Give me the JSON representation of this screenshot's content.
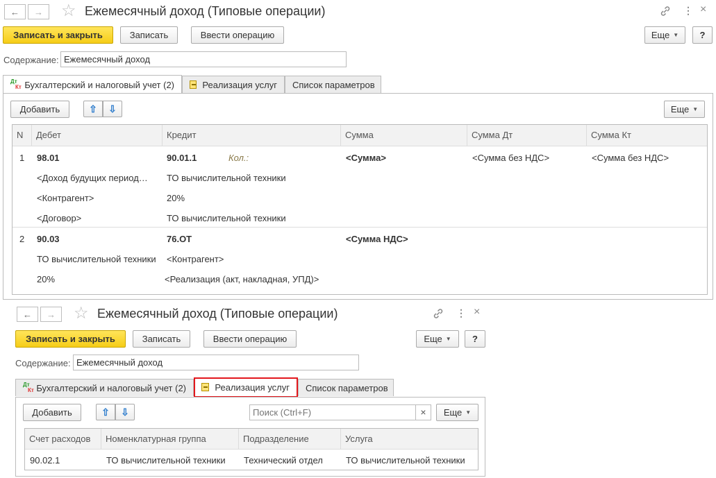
{
  "window1": {
    "title": "Ежемесячный доход (Типовые операции)",
    "buttons": {
      "save_close": "Записать и закрыть",
      "save": "Записать",
      "enter_op": "Ввести операцию",
      "more": "Еще",
      "help": "?"
    },
    "content_label": "Содержание:",
    "content_value": "Ежемесячный доход",
    "tabs": [
      "Бухгалтерский и налоговый учет (2)",
      "Реализация услуг",
      "Список параметров"
    ],
    "tab_icon_top": "Дт",
    "tab_icon_bottom": "Кт",
    "add_label": "Добавить",
    "more_label": "Еще",
    "columns": [
      "N",
      "Дебет",
      "Кредит",
      "Сумма",
      "Сумма Дт",
      "Сумма Кт"
    ],
    "rows": [
      {
        "n": "1",
        "debit": [
          "98.01",
          "<Доход будущих период…",
          "<Контрагент>",
          "<Договор>"
        ],
        "credit": [
          "90.01.1",
          "ТО вычислительной техники",
          "20%",
          "ТО вычислительной техники"
        ],
        "qty": "Кол.:",
        "sum": "<Сумма>",
        "sum_dt": "<Сумма без НДС>",
        "sum_kt": "<Сумма без НДС>"
      },
      {
        "n": "2",
        "debit": [
          "90.03",
          "ТО вычислительной техники",
          "20%"
        ],
        "credit": [
          "76.ОТ",
          "<Контрагент>",
          "<Реализация (акт, накладная, УПД)>"
        ],
        "sum": "<Сумма НДС>"
      }
    ]
  },
  "window2": {
    "title": "Ежемесячный доход (Типовые операции)",
    "buttons": {
      "save_close": "Записать и закрыть",
      "save": "Записать",
      "enter_op": "Ввести операцию",
      "more": "Еще",
      "help": "?"
    },
    "content_label": "Содержание:",
    "content_value": "Ежемесячный доход",
    "tabs": [
      "Бухгалтерский и налоговый учет (2)",
      "Реализация услуг",
      "Список параметров"
    ],
    "tab_icon_top": "Дт",
    "tab_icon_bottom": "Кт",
    "add_label": "Добавить",
    "search_placeholder": "Поиск (Ctrl+F)",
    "clear": "×",
    "more_label": "Еще",
    "columns": [
      "Счет расходов",
      "Номенклатурная группа",
      "Подразделение",
      "Услуга"
    ],
    "row": [
      "90.02.1",
      "ТО вычислительной техники",
      "Технический отдел",
      "ТО вычислительной техники"
    ]
  },
  "icons": {
    "back": "←",
    "forward": "→",
    "star": "☆",
    "link": "🔗",
    "menu": "⋮",
    "close": "×",
    "up": "⇧",
    "down": "⇩",
    "caret": "▼"
  },
  "colors": {
    "primary": "#f6cd18",
    "highlight": "#e3171c"
  }
}
